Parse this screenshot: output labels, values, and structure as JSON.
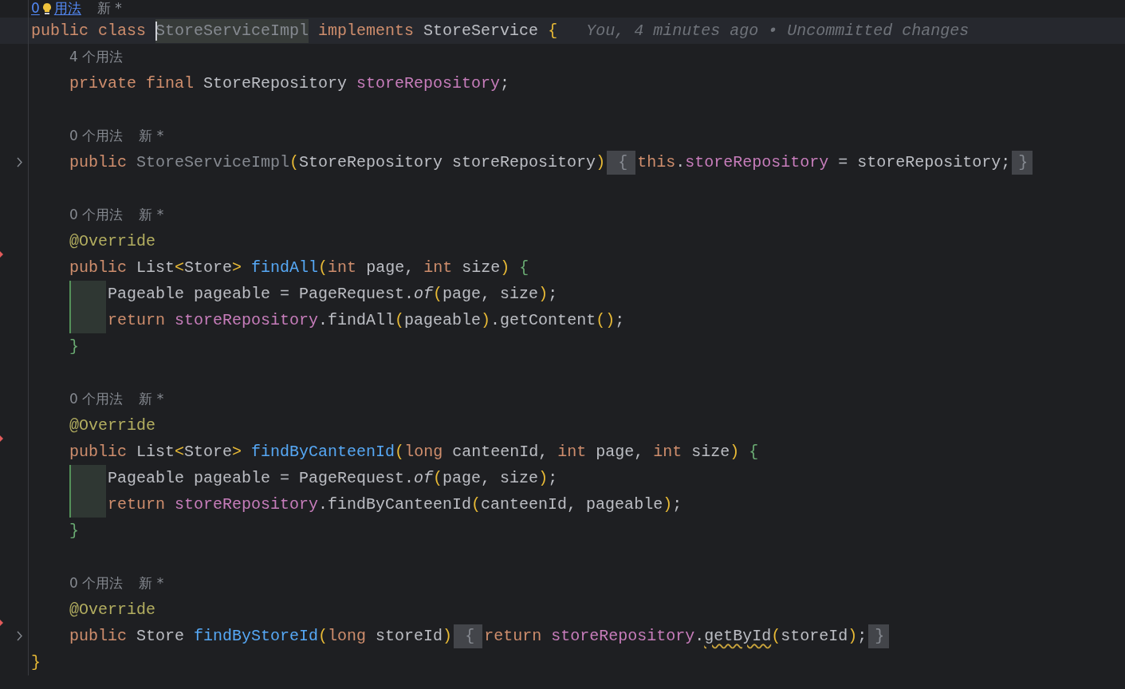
{
  "editor": {
    "lines": [
      {
        "kind": "hint",
        "usages": "0",
        "usages_tail": "用法",
        "link": true,
        "author": "新 *"
      },
      {
        "kind": "code",
        "current": true,
        "blame": "You, 4 minutes ago • Uncommitted changes",
        "tokens": [
          {
            "text": "public class ",
            "kind": "keyword"
          },
          {
            "text": "StoreServiceImpl",
            "kind": "unused",
            "highlight": true,
            "caret": true
          },
          {
            "text": " implements ",
            "kind": "keyword"
          },
          {
            "text": "StoreService ",
            "kind": "ident"
          },
          {
            "text": "{",
            "kind": "bracket"
          }
        ],
        "children": [
          {
            "kind": "hint",
            "usages": "4 个用法"
          },
          {
            "kind": "code",
            "tokens": [
              {
                "text": "private final ",
                "kind": "keyword"
              },
              {
                "text": "StoreRepository ",
                "kind": "ident"
              },
              {
                "text": "storeRepository",
                "kind": "field"
              },
              {
                "text": ";",
                "kind": "ident"
              }
            ]
          },
          {
            "kind": "blank"
          },
          {
            "kind": "hint",
            "usages": "0 个用法",
            "author": "新 *"
          },
          {
            "kind": "code",
            "folded": true,
            "tokens": [
              {
                "text": "public ",
                "kind": "keyword"
              },
              {
                "text": "StoreServiceImpl",
                "kind": "unused"
              },
              {
                "text": "(",
                "kind": "bracket"
              },
              {
                "text": "StoreRepository storeRepository",
                "kind": "ident"
              },
              {
                "text": ")",
                "kind": "bracket"
              },
              {
                "text": "{",
                "kind": "foldopen"
              },
              {
                "text": "this",
                "kind": "keyword"
              },
              {
                "text": ".",
                "kind": "ident"
              },
              {
                "text": "storeRepository",
                "kind": "field"
              },
              {
                "text": " = storeRepository;",
                "kind": "ident"
              },
              {
                "text": "}",
                "kind": "foldclose"
              }
            ]
          },
          {
            "kind": "blank"
          },
          {
            "kind": "hint",
            "usages": "0 个用法",
            "author": "新 *"
          },
          {
            "kind": "code",
            "tokens": [
              {
                "text": "@Override",
                "kind": "annotation"
              }
            ]
          },
          {
            "kind": "code",
            "deleted": true,
            "tokens": [
              {
                "text": "public ",
                "kind": "keyword"
              },
              {
                "text": "List",
                "kind": "ident"
              },
              {
                "text": "<",
                "kind": "bracket"
              },
              {
                "text": "Store",
                "kind": "ident"
              },
              {
                "text": "> ",
                "kind": "bracket"
              },
              {
                "text": "findAll",
                "kind": "method"
              },
              {
                "text": "(",
                "kind": "bracket"
              },
              {
                "text": "int ",
                "kind": "keyword"
              },
              {
                "text": "page, ",
                "kind": "ident"
              },
              {
                "text": "int ",
                "kind": "keyword"
              },
              {
                "text": "size",
                "kind": "ident"
              },
              {
                "text": ") ",
                "kind": "bracket"
              },
              {
                "text": "{",
                "kind": "block"
              }
            ],
            "children": [
              {
                "kind": "code",
                "changed": true,
                "tokens": [
                  {
                    "text": "Pageable pageable = PageRequest.",
                    "kind": "ident"
                  },
                  {
                    "text": "of",
                    "kind": "static"
                  },
                  {
                    "text": "(",
                    "kind": "bracket"
                  },
                  {
                    "text": "page, size",
                    "kind": "ident"
                  },
                  {
                    "text": ")",
                    "kind": "bracket"
                  },
                  {
                    "text": ";",
                    "kind": "ident"
                  }
                ]
              },
              {
                "kind": "code",
                "changed": true,
                "tokens": [
                  {
                    "text": "return ",
                    "kind": "keyword"
                  },
                  {
                    "text": "storeRepository",
                    "kind": "field"
                  },
                  {
                    "text": ".findAll",
                    "kind": "ident"
                  },
                  {
                    "text": "(",
                    "kind": "bracket"
                  },
                  {
                    "text": "pageable",
                    "kind": "ident"
                  },
                  {
                    "text": ")",
                    "kind": "bracket"
                  },
                  {
                    "text": ".getContent",
                    "kind": "ident"
                  },
                  {
                    "text": "()",
                    "kind": "bracket"
                  },
                  {
                    "text": ";",
                    "kind": "ident"
                  }
                ]
              }
            ]
          },
          {
            "kind": "code",
            "tokens": [
              {
                "text": "}",
                "kind": "block"
              }
            ]
          },
          {
            "kind": "blank"
          },
          {
            "kind": "hint",
            "usages": "0 个用法",
            "author": "新 *"
          },
          {
            "kind": "code",
            "tokens": [
              {
                "text": "@Override",
                "kind": "annotation"
              }
            ]
          },
          {
            "kind": "code",
            "deleted": true,
            "tokens": [
              {
                "text": "public ",
                "kind": "keyword"
              },
              {
                "text": "List",
                "kind": "ident"
              },
              {
                "text": "<",
                "kind": "bracket"
              },
              {
                "text": "Store",
                "kind": "ident"
              },
              {
                "text": "> ",
                "kind": "bracket"
              },
              {
                "text": "findByCanteenId",
                "kind": "method"
              },
              {
                "text": "(",
                "kind": "bracket"
              },
              {
                "text": "long ",
                "kind": "keyword"
              },
              {
                "text": "canteenId, ",
                "kind": "ident"
              },
              {
                "text": "int ",
                "kind": "keyword"
              },
              {
                "text": "page, ",
                "kind": "ident"
              },
              {
                "text": "int ",
                "kind": "keyword"
              },
              {
                "text": "size",
                "kind": "ident"
              },
              {
                "text": ") ",
                "kind": "bracket"
              },
              {
                "text": "{",
                "kind": "block"
              }
            ],
            "children": [
              {
                "kind": "code",
                "changed": true,
                "tokens": [
                  {
                    "text": "Pageable pageable = PageRequest.",
                    "kind": "ident"
                  },
                  {
                    "text": "of",
                    "kind": "static"
                  },
                  {
                    "text": "(",
                    "kind": "bracket"
                  },
                  {
                    "text": "page, size",
                    "kind": "ident"
                  },
                  {
                    "text": ")",
                    "kind": "bracket"
                  },
                  {
                    "text": ";",
                    "kind": "ident"
                  }
                ]
              },
              {
                "kind": "code",
                "changed": true,
                "tokens": [
                  {
                    "text": "return ",
                    "kind": "keyword"
                  },
                  {
                    "text": "storeRepository",
                    "kind": "field"
                  },
                  {
                    "text": ".findByCanteenId",
                    "kind": "ident"
                  },
                  {
                    "text": "(",
                    "kind": "bracket"
                  },
                  {
                    "text": "canteenId, pageable",
                    "kind": "ident"
                  },
                  {
                    "text": ")",
                    "kind": "bracket"
                  },
                  {
                    "text": ";",
                    "kind": "ident"
                  }
                ]
              }
            ]
          },
          {
            "kind": "code",
            "tokens": [
              {
                "text": "}",
                "kind": "block"
              }
            ]
          },
          {
            "kind": "blank"
          },
          {
            "kind": "hint",
            "usages": "0 个用法",
            "author": "新 *"
          },
          {
            "kind": "code",
            "tokens": [
              {
                "text": "@Override",
                "kind": "annotation"
              }
            ]
          },
          {
            "kind": "code",
            "deleted": true,
            "folded": true,
            "tokens": [
              {
                "text": "public ",
                "kind": "keyword"
              },
              {
                "text": "Store ",
                "kind": "ident"
              },
              {
                "text": "findByStoreId",
                "kind": "method"
              },
              {
                "text": "(",
                "kind": "bracket"
              },
              {
                "text": "long ",
                "kind": "keyword"
              },
              {
                "text": "storeId",
                "kind": "ident"
              },
              {
                "text": ")",
                "kind": "bracket"
              },
              {
                "text": "{",
                "kind": "foldopen"
              },
              {
                "text": "return ",
                "kind": "keyword"
              },
              {
                "text": "storeRepository",
                "kind": "field"
              },
              {
                "text": ".",
                "kind": "ident"
              },
              {
                "text": "getById",
                "kind": "ident",
                "warning": true
              },
              {
                "text": "(",
                "kind": "bracket"
              },
              {
                "text": "storeId",
                "kind": "ident"
              },
              {
                "text": ")",
                "kind": "bracket"
              },
              {
                "text": ";",
                "kind": "ident"
              },
              {
                "text": "}",
                "kind": "foldclose"
              }
            ]
          }
        ]
      },
      {
        "kind": "code",
        "tokens": [
          {
            "text": "}",
            "kind": "bracket"
          }
        ]
      }
    ]
  }
}
